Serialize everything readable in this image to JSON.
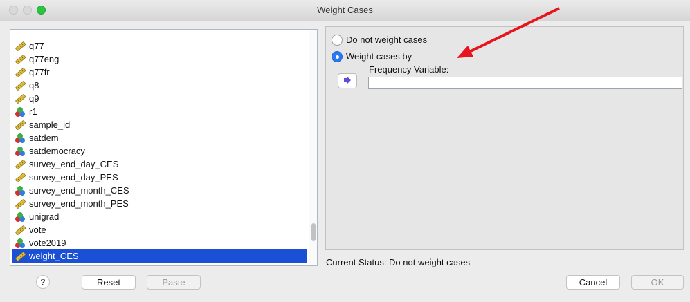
{
  "window": {
    "title": "Weight Cases"
  },
  "variables": [
    {
      "name": "q77",
      "icon": "scale-ruler-icon"
    },
    {
      "name": "q77eng",
      "icon": "scale-ruler-icon"
    },
    {
      "name": "q77fr",
      "icon": "scale-ruler-icon"
    },
    {
      "name": "q8",
      "icon": "scale-ruler-icon"
    },
    {
      "name": "q9",
      "icon": "scale-ruler-icon"
    },
    {
      "name": "r1",
      "icon": "nominal-balls-icon"
    },
    {
      "name": "sample_id",
      "icon": "scale-ruler-icon"
    },
    {
      "name": "satdem",
      "icon": "nominal-balls-icon"
    },
    {
      "name": "satdemocracy",
      "icon": "nominal-balls-icon"
    },
    {
      "name": "survey_end_day_CES",
      "icon": "scale-ruler-icon"
    },
    {
      "name": "survey_end_day_PES",
      "icon": "scale-ruler-icon"
    },
    {
      "name": "survey_end_month_CES",
      "icon": "nominal-balls-icon"
    },
    {
      "name": "survey_end_month_PES",
      "icon": "scale-ruler-icon"
    },
    {
      "name": "unigrad",
      "icon": "nominal-balls-icon"
    },
    {
      "name": "vote",
      "icon": "scale-ruler-icon"
    },
    {
      "name": "vote2019",
      "icon": "nominal-balls-icon"
    },
    {
      "name": "weight_CES",
      "icon": "scale-ruler-icon",
      "selected": true
    }
  ],
  "options": {
    "do_not_weight": "Do not weight cases",
    "weight_by": "Weight cases by",
    "selected": "weight_by"
  },
  "frequency_variable": {
    "label": "Frequency Variable:",
    "value": ""
  },
  "status": "Current Status: Do not weight cases",
  "buttons": {
    "help": "?",
    "reset": "Reset",
    "paste": "Paste",
    "cancel": "Cancel",
    "ok": "OK"
  },
  "colors": {
    "selection": "#1a50d6",
    "radio_on": "#2a79f3",
    "annotation_arrow": "#e8141b"
  }
}
